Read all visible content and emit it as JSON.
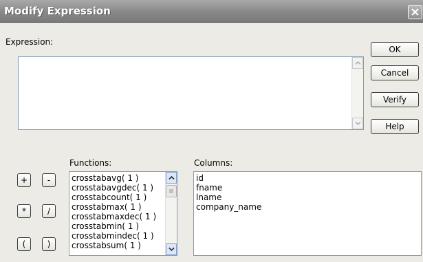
{
  "window": {
    "title": "Modify Expression"
  },
  "labels": {
    "expression": "Expression:",
    "functions": "Functions:",
    "columns": "Columns:"
  },
  "expression": {
    "value": ""
  },
  "buttons": {
    "ok": "OK",
    "cancel": "Cancel",
    "verify": "Verify",
    "help": "Help"
  },
  "operators": [
    "+",
    "-",
    "*",
    "/",
    "(",
    ")"
  ],
  "functions": [
    "crosstabavg( 1 )",
    "crosstabavgdec( 1 )",
    "crosstabcount( 1 )",
    "crosstabmax( 1 )",
    "crosstabmaxdec( 1 )",
    "crosstabmin( 1 )",
    "crosstabmindec( 1 )",
    "crosstabsum( 1 )"
  ],
  "columns": [
    "id",
    "fname",
    "lname",
    "company_name"
  ]
}
